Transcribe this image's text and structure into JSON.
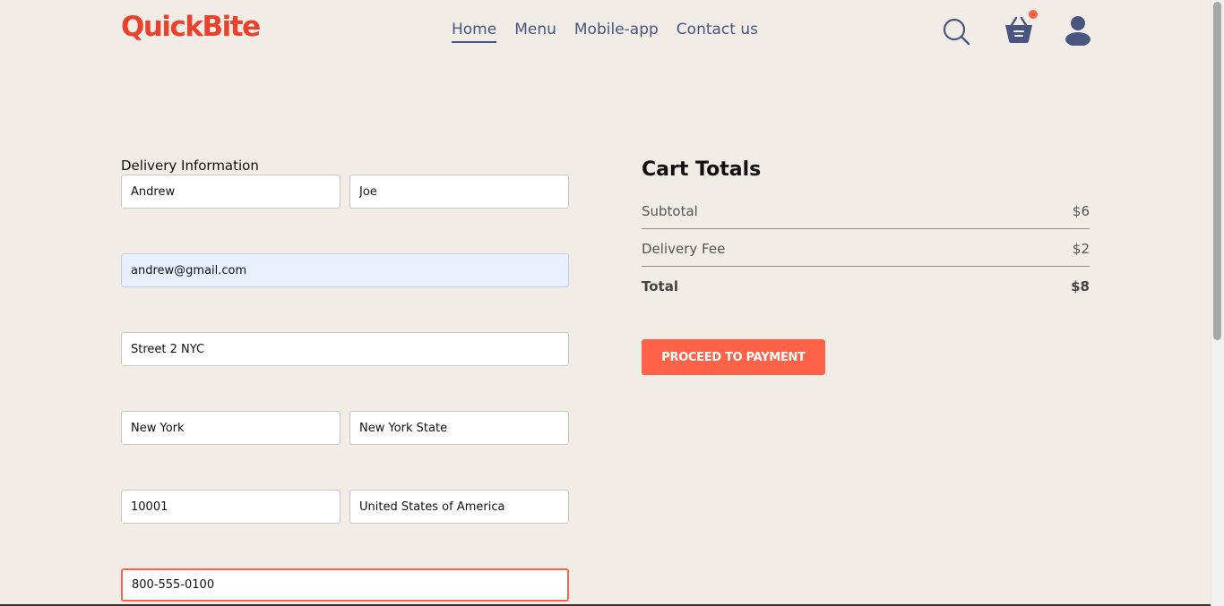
{
  "header": {
    "logo": "QuickBite",
    "nav": [
      "Home",
      "Menu",
      "Mobile-app",
      "Contact us"
    ],
    "icons": [
      "search-icon",
      "basket-icon",
      "profile-icon"
    ],
    "cart_has_items": true
  },
  "delivery": {
    "title": "Delivery Information",
    "first_name": "Andrew",
    "last_name": "Joe",
    "email": "andrew@gmail.com",
    "street": "Street 2 NYC",
    "city": "New York",
    "state": "New York State",
    "zip": "10001",
    "country": "United States of America",
    "phone": "800-555-0100"
  },
  "cart": {
    "title": "Cart Totals",
    "subtotal_label": "Subtotal",
    "subtotal_value": "$6",
    "delivery_label": "Delivery Fee",
    "delivery_value": "$2",
    "total_label": "Total",
    "total_value": "$8",
    "button_label": "PROCEED TO PAYMENT"
  },
  "colors": {
    "brand": "#e8412e",
    "accent": "#ff6347",
    "nav_text": "#49557e",
    "background": "#f1ece6"
  }
}
